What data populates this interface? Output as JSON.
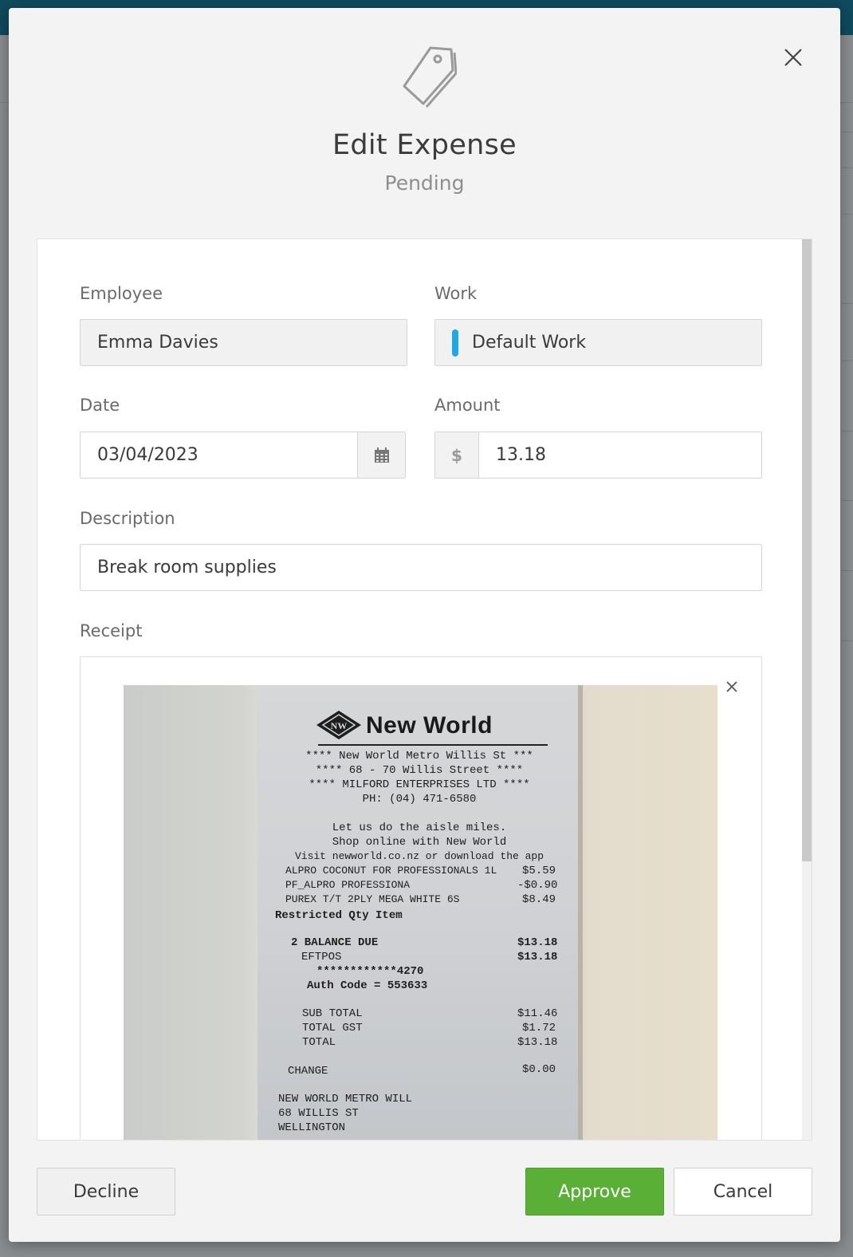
{
  "dialog": {
    "title": "Edit Expense",
    "status": "Pending",
    "icons": {
      "header": "tag-icon",
      "close": "close-icon"
    }
  },
  "form": {
    "employee": {
      "label": "Employee",
      "value": "Emma Davies"
    },
    "work": {
      "label": "Work",
      "value": "Default Work",
      "marker_color": "#1da8e6"
    },
    "date": {
      "label": "Date",
      "value": "03/04/2023",
      "icon": "calendar-icon"
    },
    "amount": {
      "label": "Amount",
      "currency_symbol": "$",
      "value": "13.18"
    },
    "description": {
      "label": "Description",
      "value": "Break room supplies"
    },
    "receipt": {
      "label": "Receipt",
      "remove_icon": "close-icon",
      "image": {
        "brand_badge": "NW",
        "brand": "New World",
        "lines": [
          "**** New World Metro Willis St ***",
          "**** 68 - 70 Willis Street ****",
          "**** MILFORD ENTERPRISES LTD ****",
          "PH: (04) 471-6580",
          "Let us do the aisle miles.",
          "Shop online with New World",
          "Visit newworld.co.nz or download the app"
        ],
        "items": [
          {
            "name": "ALPRO COCONUT FOR PROFESSIONALS 1L",
            "price": "$5.59"
          },
          {
            "name": "PF_ALPRO PROFESSIONA",
            "price": "-$0.90"
          },
          {
            "name": "PUREX T/T 2PLY MEGA WHITE 6S",
            "price": "$8.49"
          }
        ],
        "restricted": "Restricted Qty Item",
        "balance_due": {
          "label": "2 BALANCE DUE",
          "value": "$13.18"
        },
        "eftpos": {
          "label": "EFTPOS",
          "value": "$13.18"
        },
        "card": "************4270",
        "auth": "Auth Code = 553633",
        "subtotal": {
          "label": "SUB TOTAL",
          "value": "$11.46"
        },
        "gst": {
          "label": "TOTAL GST",
          "value": "$1.72"
        },
        "total": {
          "label": "TOTAL",
          "value": "$13.18"
        },
        "change": {
          "label": "CHANGE",
          "value": "$0.00"
        },
        "footer": [
          "NEW WORLD METRO WILL",
          "68 WILLIS ST",
          "WELLINGTON"
        ]
      }
    }
  },
  "actions": {
    "decline": "Decline",
    "approve": "Approve",
    "cancel": "Cancel"
  },
  "colors": {
    "approve": "#5aaf37",
    "topbar": "#0f4a5e"
  }
}
